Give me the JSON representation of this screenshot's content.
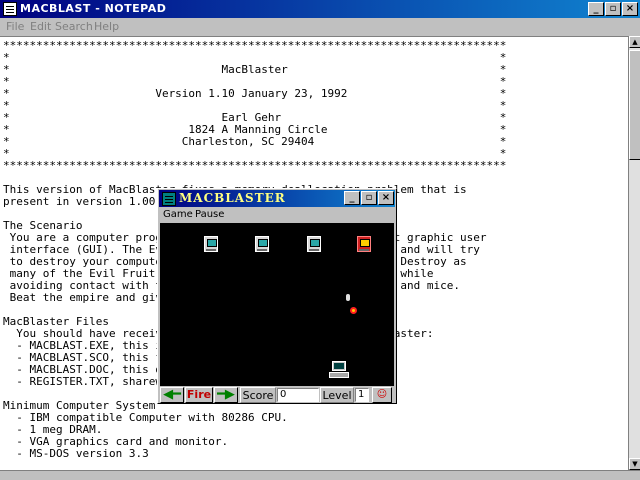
{
  "notepad": {
    "title": "MACBLAST - NOTEPAD",
    "menu": [
      "File",
      "Edit",
      "Search",
      "Help"
    ],
    "lines": [
      "****************************************************************************",
      "*                                                                          *",
      "*                                MacBlaster                                *",
      "*                                                                          *",
      "*                      Version 1.10 January 23, 1992                       *",
      "*                                                                          *",
      "*                                Earl Gehr                                 *",
      "*                           1824 A Manning Circle                          *",
      "*                          Charleston, SC 29404                            *",
      "*                                                                          *",
      "****************************************************************************",
      "",
      "This version of MacBlaster fixes a memory deallocation problem that is",
      "present in version 1.00.",
      "",
      "The Scenario",
      " You are a computer program                               nt graphic user",
      " interface (GUI). The Evi                                 s and will try",
      " to destroy your compute                                  . Destroy as",
      " many of the Evil Fruit                                   e while",
      " avoiding contact with t                                  s and mice.",
      " Beat the empire and giv",
      "",
      "MacBlaster Files",
      "  You should have receiv                                  laster:",
      "  - MACBLAST.EXE, this i",
      "  - MACBLAST.SCO, this f",
      "  - MACBLAST.DOC, this d",
      "  - REGISTER.TXT, sharew",
      "",
      "Minimum Computer System",
      "  - IBM compatible Computer with 80286 CPU.",
      "  - 1 meg DRAM.",
      "  - VGA graphics card and monitor.",
      "  - MS-DOS version 3.3"
    ]
  },
  "game": {
    "title": "MACBLASTER",
    "menu": [
      "Game",
      "Pause"
    ],
    "fire_label": "Fire",
    "score_label": "Score",
    "score_value": "0",
    "level_label": "Level",
    "level_value": "1",
    "icons": {
      "left": "left-arrow-icon",
      "right": "right-arrow-icon",
      "player": "player-computer-icon",
      "enemy": "mac-computer-icon",
      "lives": "clown-icon"
    }
  },
  "colors": {
    "titlebar": "#000080",
    "game_title_text": "#ffff80",
    "field": "#000000",
    "arrow": "#008000",
    "fire": "#c00000"
  }
}
